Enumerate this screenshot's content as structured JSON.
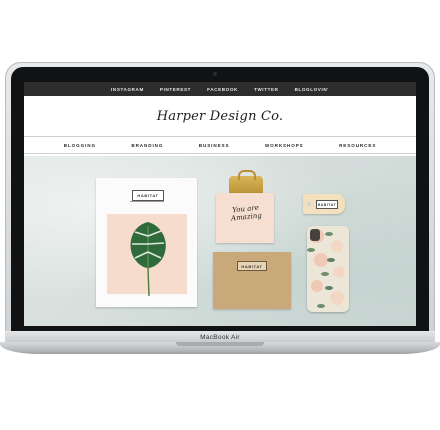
{
  "topbar": {
    "links": [
      "INSTAGRAM",
      "PINTEREST",
      "FACEBOOK",
      "TWITTER",
      "BLOGLOVIN'"
    ]
  },
  "site": {
    "logo": "Harper Design Co."
  },
  "nav": {
    "items": [
      "BLOGGING",
      "BRANDING",
      "BUSINESS",
      "WORKSHOPS",
      "RESOURCES"
    ]
  },
  "hero": {
    "brand_label": "HABITAT",
    "card_script": "You are Amazing"
  },
  "device": {
    "brand": "MacBook Air"
  },
  "colors": {
    "topbar": "#2d2d2d",
    "accent_pink": "#f5dccd",
    "kraft": "#c9a97a"
  }
}
